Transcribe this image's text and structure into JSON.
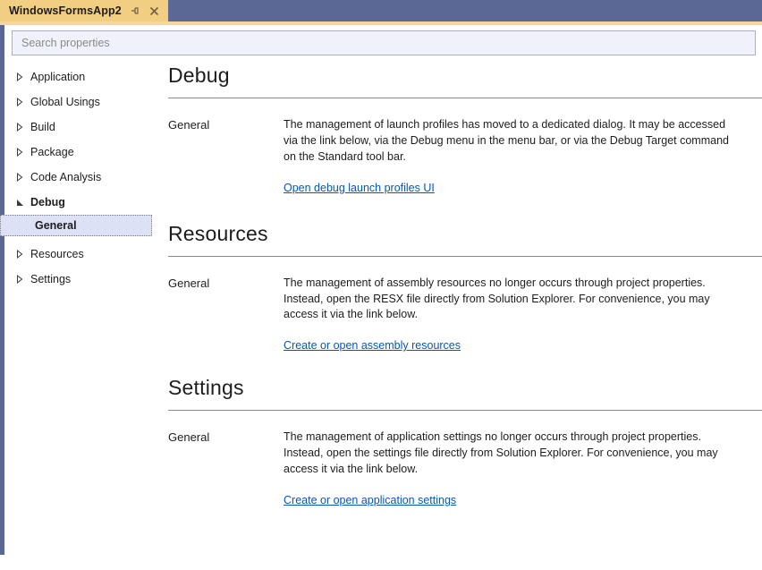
{
  "window": {
    "tab": {
      "title": "WindowsFormsApp2",
      "pin_icon": "pin-icon",
      "close_icon": "close-icon"
    },
    "colors": {
      "titlebar": "#5b6896",
      "tab_active": "#f2ce83",
      "tab_underline": "#f6d79a",
      "left_strip": "#5b6896",
      "selection": "#dde1f5",
      "link": "#0a56b5",
      "search_fill": "#eff2fb",
      "search_border": "#a7b0cd"
    }
  },
  "search": {
    "placeholder": "Search properties",
    "value": ""
  },
  "sidebar": {
    "items": [
      {
        "label": "Application",
        "state": "collapsed",
        "icon": "chevron-right-icon"
      },
      {
        "label": "Global Usings",
        "state": "collapsed",
        "icon": "chevron-right-icon"
      },
      {
        "label": "Build",
        "state": "collapsed",
        "icon": "chevron-right-icon"
      },
      {
        "label": "Package",
        "state": "collapsed",
        "icon": "chevron-right-icon"
      },
      {
        "label": "Code Analysis",
        "state": "collapsed",
        "icon": "chevron-right-icon"
      },
      {
        "label": "Debug",
        "state": "expanded",
        "icon": "chevron-down-icon"
      },
      {
        "label": "Resources",
        "state": "collapsed",
        "icon": "chevron-right-icon"
      },
      {
        "label": "Settings",
        "state": "collapsed",
        "icon": "chevron-right-icon"
      }
    ],
    "debug_child": {
      "label": "General",
      "selected": true
    }
  },
  "main": {
    "sections": [
      {
        "title": "Debug",
        "property_label": "General",
        "description": "The management of launch profiles has moved to a dedicated dialog. It may be accessed via the link below, via the Debug menu in the menu bar, or via the Debug Target command on the Standard tool bar.",
        "link": "Open debug launch profiles UI"
      },
      {
        "title": "Resources",
        "property_label": "General",
        "description": "The management of assembly resources no longer occurs through project properties. Instead, open the RESX file directly from Solution Explorer. For convenience, you may access it via the link below.",
        "link": "Create or open assembly resources"
      },
      {
        "title": "Settings",
        "property_label": "General",
        "description": "The management of application settings no longer occurs through project properties. Instead, open the settings file directly from Solution Explorer. For convenience, you may access it via the link below.",
        "link": "Create or open application settings"
      }
    ]
  }
}
